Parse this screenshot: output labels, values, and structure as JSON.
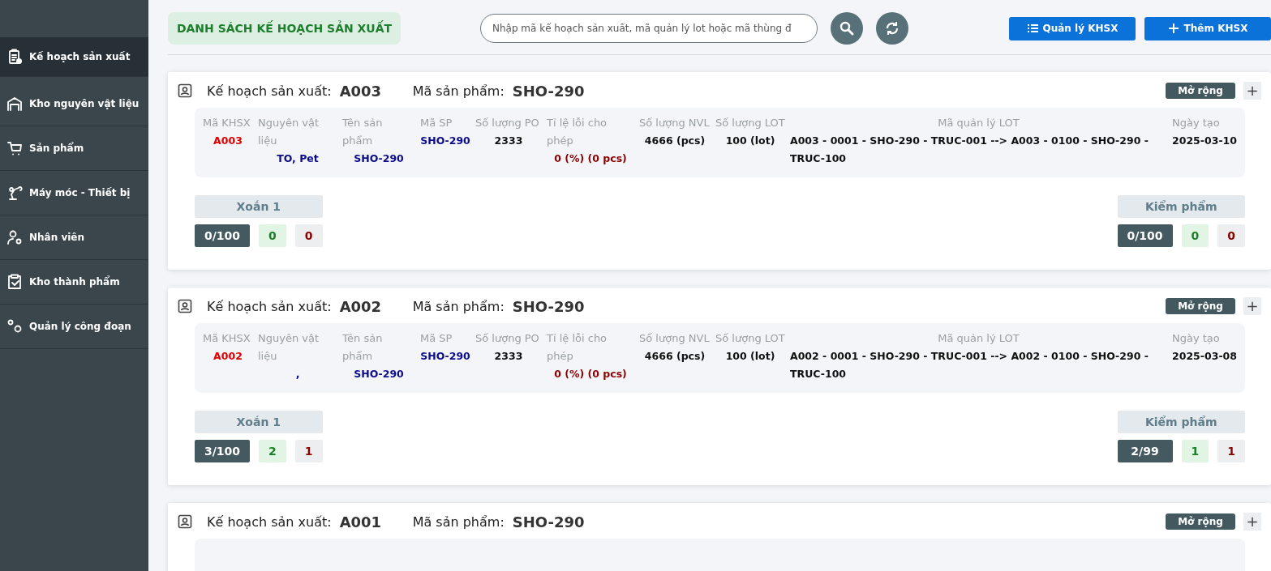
{
  "sidebar": {
    "items": [
      {
        "label": "Kế hoạch sản xuất",
        "selected": true
      },
      {
        "label": "Kho nguyên vật liệu",
        "selected": false
      },
      {
        "label": "Sản phẩm",
        "selected": false
      },
      {
        "label": "Máy móc - Thiết bị",
        "selected": false
      },
      {
        "label": "Nhân viên",
        "selected": false
      },
      {
        "label": "Kho thành phẩm",
        "selected": false
      },
      {
        "label": "Quản lý công đoạn",
        "selected": false
      }
    ]
  },
  "header": {
    "title": "DANH SÁCH KẾ HOẠCH SẢN XUẤT",
    "search": {
      "placeholder": "Nhập mã kế hoạch sản xuất, mã quản lý lot hoặc mã thùng đ"
    },
    "buttons": [
      {
        "label": "Quản lý KHSX"
      },
      {
        "label": "Thêm KHSX"
      }
    ]
  },
  "plans": [
    {
      "plan_label": "Kế hoạch sản xuất:",
      "plan_code": "A003",
      "product_label": "Mã sản phẩm:",
      "product_code": "SHO-290",
      "expand": "Mở rộng",
      "add": "+",
      "fields": [
        {
          "label": "Mã KHSX",
          "value": "A003",
          "kind": "code"
        },
        {
          "label": "Nguyên vật liệu",
          "value": "TO, Pet",
          "kind": "ref"
        },
        {
          "label": "Tên sản phẩm",
          "value": "SHO-290",
          "kind": "ref"
        },
        {
          "label": "Mã SP",
          "value": "SHO-290",
          "kind": "ref"
        },
        {
          "label": "Số lượng PO",
          "value": "2333",
          "kind": "plain"
        },
        {
          "label": "Tỉ lệ lỗi cho phép",
          "value": "0 (%) (0 pcs)",
          "kind": "error"
        },
        {
          "label": "Số lượng NVL",
          "value": "4666 (pcs)",
          "kind": "plain"
        },
        {
          "label": "Số lượng LOT",
          "value": "100 (lot)",
          "kind": "plain"
        },
        {
          "label": "Mã quản lý LOT",
          "value": "A003 - 0001 - SHO-290 - TRUC-001 --> A003 - 0100 - SHO-290 - TRUC-100",
          "kind": "plain"
        },
        {
          "label": "Ngày tạo",
          "value": "2025-03-10",
          "kind": "plain"
        }
      ],
      "stages": [
        {
          "name": "Xoắn 1",
          "progress": "0/100",
          "ok": "0",
          "ng": "0"
        },
        {
          "name": "Kiểm phẩm",
          "progress": "0/100",
          "ok": "0",
          "ng": "0"
        }
      ]
    },
    {
      "plan_label": "Kế hoạch sản xuất:",
      "plan_code": "A002",
      "product_label": "Mã sản phẩm:",
      "product_code": "SHO-290",
      "expand": "Mở rộng",
      "add": "+",
      "fields": [
        {
          "label": "Mã KHSX",
          "value": "A002",
          "kind": "code"
        },
        {
          "label": "Nguyên vật liệu",
          "value": ",",
          "kind": "ref"
        },
        {
          "label": "Tên sản phẩm",
          "value": "SHO-290",
          "kind": "ref"
        },
        {
          "label": "Mã SP",
          "value": "SHO-290",
          "kind": "ref"
        },
        {
          "label": "Số lượng PO",
          "value": "2333",
          "kind": "plain"
        },
        {
          "label": "Tỉ lệ lỗi cho phép",
          "value": "0 (%) (0 pcs)",
          "kind": "error"
        },
        {
          "label": "Số lượng NVL",
          "value": "4666 (pcs)",
          "kind": "plain"
        },
        {
          "label": "Số lượng LOT",
          "value": "100 (lot)",
          "kind": "plain"
        },
        {
          "label": "Mã quản lý LOT",
          "value": "A002 - 0001 - SHO-290 - TRUC-001 --> A002 - 0100 - SHO-290 - TRUC-100",
          "kind": "plain"
        },
        {
          "label": "Ngày tạo",
          "value": "2025-03-08",
          "kind": "plain"
        }
      ],
      "stages": [
        {
          "name": "Xoắn 1",
          "progress": "3/100",
          "ok": "2",
          "ng": "1"
        },
        {
          "name": "Kiểm phẩm",
          "progress": "2/99",
          "ok": "1",
          "ng": "1"
        }
      ]
    },
    {
      "plan_label": "Kế hoạch sản xuất:",
      "plan_code": "A001",
      "product_label": "Mã sản phẩm:",
      "product_code": "SHO-290",
      "expand": "Mở rộng",
      "add": "+"
    }
  ]
}
